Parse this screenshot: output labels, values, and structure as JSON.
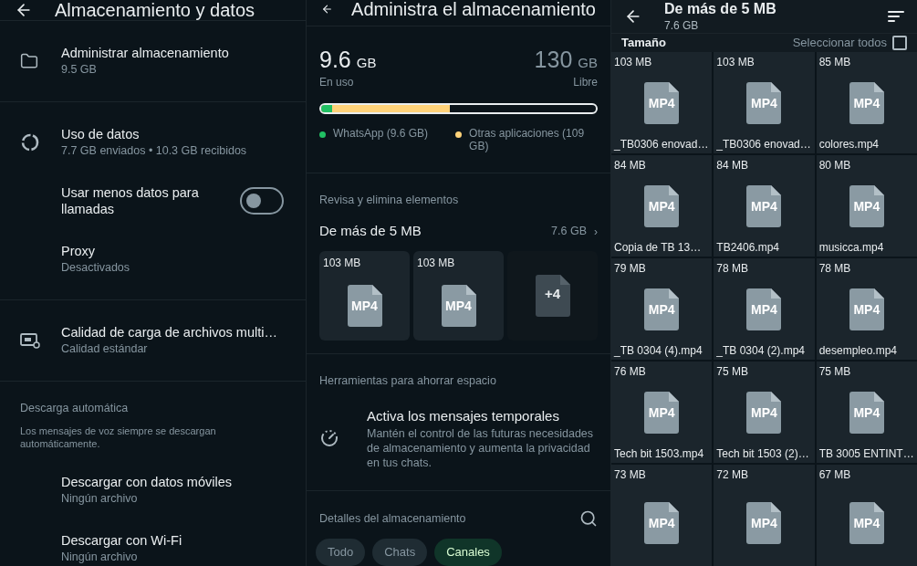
{
  "settings": {
    "title": "Almacenamiento y datos",
    "sections": [
      {
        "rows": [
          {
            "kind": "folder",
            "title": "Administrar almacenamiento",
            "subtitle": "9.5 GB"
          }
        ]
      },
      {
        "rows": [
          {
            "kind": "usage",
            "title": "Uso de datos",
            "subtitle": "7.7 GB enviados • 10.3 GB recibidos"
          },
          {
            "kind": "toggle",
            "title": "Usar menos datos para llamadas",
            "on": false
          },
          {
            "kind": "plain",
            "title": "Proxy",
            "subtitle": "Desactivados"
          }
        ]
      },
      {
        "rows": [
          {
            "kind": "hd",
            "title": "Calidad de carga de archivos multi…",
            "subtitle": "Calidad estándar"
          }
        ]
      },
      {
        "header": "Descarga automática",
        "note": "Los mensajes de voz siempre se descargan automáticamente.",
        "rows": [
          {
            "kind": "plain",
            "title": "Descargar con datos móviles",
            "subtitle": "Ningún archivo"
          },
          {
            "kind": "plain",
            "title": "Descargar con Wi-Fi",
            "subtitle": "Ningún archivo"
          }
        ]
      }
    ]
  },
  "manage": {
    "title": "Administra el almacenamiento",
    "used": {
      "value": "9.6",
      "unit": "GB",
      "label": "En uso"
    },
    "free": {
      "value": "130",
      "unit": "GB",
      "label": "Libre"
    },
    "bar": [
      {
        "color": "#21c063",
        "level": 0.04
      },
      {
        "color": "#ffd279",
        "level": 0.47
      }
    ],
    "legend": [
      {
        "label": "WhatsApp (9.6 GB)",
        "color": "#21c063"
      },
      {
        "label": "Otras aplicaciones (109 GB)",
        "color": "#ffd279"
      }
    ],
    "review": {
      "header": "Revisa y elimina elementos",
      "title": "De más de 5 MB",
      "size": "7.6 GB",
      "chevron": "›",
      "thumbs": [
        {
          "kind": "file",
          "size": "103 MB",
          "type": "MP4"
        },
        {
          "kind": "file",
          "size": "103 MB",
          "type": "MP4"
        },
        {
          "kind": "more",
          "count": "+4"
        }
      ]
    },
    "tools": {
      "header": "Herramientas para ahorrar espacio",
      "title": "Activa los mensajes temporales",
      "text": "Mantén el control de las futuras necesidades de almacenamiento y aumenta la privacidad en tus chats."
    },
    "details": {
      "header": "Detalles del almacenamiento",
      "chips": [
        {
          "label": "Todo",
          "selected": false
        },
        {
          "label": "Chats",
          "selected": false
        },
        {
          "label": "Canales",
          "selected": true
        }
      ]
    }
  },
  "files": {
    "title": "De más de 5 MB",
    "subtitle": "7.6 GB",
    "sort_label": "Tamaño",
    "select_all": {
      "label": "Seleccionar todos",
      "checked": false
    },
    "items": [
      {
        "size": "103 MB",
        "type": "MP4",
        "name": "_TB0306 enovad…"
      },
      {
        "size": "103 MB",
        "type": "MP4",
        "name": "_TB0306 enovad…"
      },
      {
        "size": "85 MB",
        "type": "MP4",
        "name": "colores.mp4"
      },
      {
        "size": "84 MB",
        "type": "MP4",
        "name": "Copia de  TB 13…"
      },
      {
        "size": "84 MB",
        "type": "MP4",
        "name": "TB2406.mp4"
      },
      {
        "size": "80 MB",
        "type": "MP4",
        "name": "musicca.mp4"
      },
      {
        "size": "79 MB",
        "type": "MP4",
        "name": "_TB 0304 (4).mp4"
      },
      {
        "size": "78 MB",
        "type": "MP4",
        "name": "_TB 0304 (2).mp4"
      },
      {
        "size": "78 MB",
        "type": "MP4",
        "name": "desempleo.mp4"
      },
      {
        "size": "76 MB",
        "type": "MP4",
        "name": "Tech bit 1503.mp4"
      },
      {
        "size": "75 MB",
        "type": "MP4",
        "name": "Tech bit 1503 (2)…"
      },
      {
        "size": "75 MB",
        "type": "MP4",
        "name": "TB 3005 ENTINT…"
      },
      {
        "size": "73 MB",
        "type": "MP4"
      },
      {
        "size": "72 MB",
        "type": "MP4"
      },
      {
        "size": "67 MB",
        "type": "MP4"
      }
    ]
  }
}
